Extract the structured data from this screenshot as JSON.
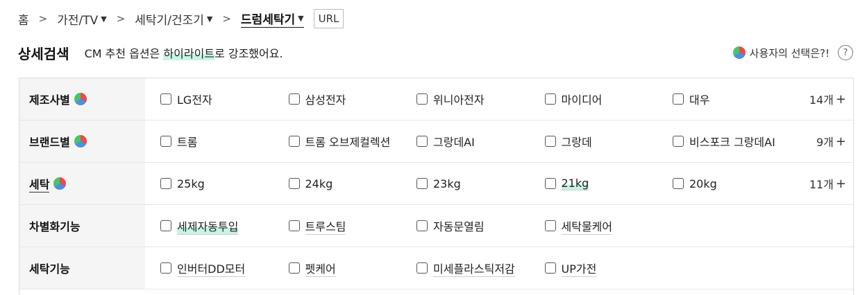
{
  "breadcrumb": {
    "home": "홈",
    "level1": "가전/TV",
    "level2": "세탁기/건조기",
    "level3": "드럼세탁기",
    "url_button": "URL"
  },
  "header": {
    "title": "상세검색",
    "subtitle_prefix": "CM 추천 옵션은 ",
    "subtitle_highlight": "하이라이트",
    "subtitle_suffix": "로 강조했어요.",
    "user_choice": "사용자의 선택은?!",
    "help": "?"
  },
  "filters": {
    "manufacturer": {
      "label": "제조사별",
      "options": [
        "LG전자",
        "삼성전자",
        "위니아전자",
        "마이디어",
        "대우"
      ],
      "more": "14개"
    },
    "brand": {
      "label": "브랜드별",
      "options": [
        "트롬",
        "트롬 오브제컬렉션",
        "그랑데AI",
        "그랑데",
        "비스포크 그랑데AI"
      ],
      "more": "9개"
    },
    "washing": {
      "label": "세탁",
      "options": [
        "25kg",
        "24kg",
        "23kg",
        "21kg",
        "20kg"
      ],
      "more": "11개"
    },
    "differentiation": {
      "label": "차별화기능",
      "options": [
        "세제자동투입",
        "트루스팀",
        "자동문열림",
        "세탁물케어"
      ]
    },
    "wash_function": {
      "label": "세탁기능",
      "options": [
        "인버터DD모터",
        "펫케어",
        "미세플라스틱저감",
        "UP가전"
      ]
    }
  },
  "colors": {
    "highlight": "#c7f4e3",
    "label_bg": "#f5f5f5",
    "border": "#dddddd"
  },
  "icons": {
    "chevron": "chevron-right-icon",
    "dropdown": "triangle-down-icon",
    "pie": "pie-chart-icon",
    "help": "question-circle-icon",
    "plus": "plus-icon"
  }
}
